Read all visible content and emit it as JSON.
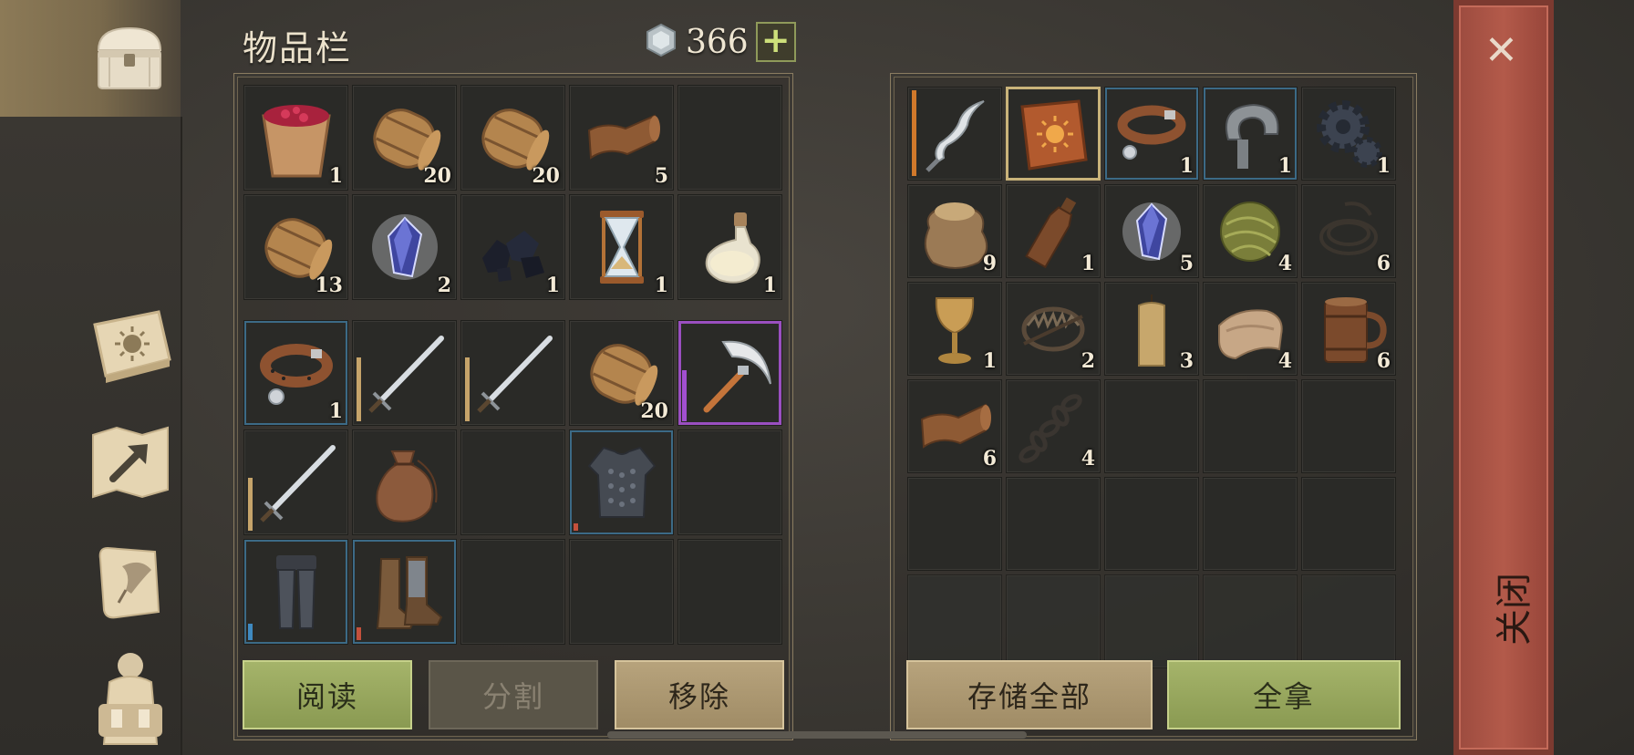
{
  "inventory": {
    "title": "物品栏",
    "currency": {
      "icon": "gem-coin-icon",
      "value": "366",
      "add_label": "+"
    },
    "top_slots": [
      {
        "icon": "berry-bucket-icon",
        "count": "1"
      },
      {
        "icon": "barrel-icon",
        "count": "20"
      },
      {
        "icon": "barrel-icon",
        "count": "20"
      },
      {
        "icon": "leather-scroll-icon",
        "count": "5"
      },
      {
        "icon": "",
        "count": ""
      },
      {
        "icon": "barrel-icon",
        "count": "13"
      },
      {
        "icon": "crystal-icon",
        "count": "2"
      },
      {
        "icon": "coal-icon",
        "count": "1"
      },
      {
        "icon": "hourglass-icon",
        "count": "1"
      },
      {
        "icon": "potion-icon",
        "count": "1"
      }
    ],
    "bottom_slots": [
      {
        "icon": "collar-icon",
        "count": "1"
      },
      {
        "icon": "sword-icon",
        "count": ""
      },
      {
        "icon": "sword-icon",
        "count": ""
      },
      {
        "icon": "barrel-icon",
        "count": "20"
      },
      {
        "icon": "scythe-icon",
        "count": ""
      },
      {
        "icon": "sword-icon",
        "count": ""
      },
      {
        "icon": "pouch-icon",
        "count": ""
      },
      {
        "icon": "",
        "count": ""
      },
      {
        "icon": "chainmail-icon",
        "count": ""
      },
      {
        "icon": "",
        "count": ""
      },
      {
        "icon": "leg-armor-icon",
        "count": ""
      },
      {
        "icon": "boots-icon",
        "count": ""
      },
      {
        "icon": "",
        "count": ""
      },
      {
        "icon": "",
        "count": ""
      },
      {
        "icon": "",
        "count": ""
      }
    ],
    "buttons": {
      "read": "阅读",
      "split": "分割",
      "remove": "移除"
    }
  },
  "container": {
    "slots": [
      {
        "icon": "curved-dagger-icon",
        "count": ""
      },
      {
        "icon": "sun-book-icon",
        "count": ""
      },
      {
        "icon": "collar-icon",
        "count": "1"
      },
      {
        "icon": "clamp-icon",
        "count": "1"
      },
      {
        "icon": "gear-icon",
        "count": "1"
      },
      {
        "icon": "grain-sack-icon",
        "count": "9"
      },
      {
        "icon": "bottle-icon",
        "count": "1"
      },
      {
        "icon": "crystal-icon",
        "count": "5"
      },
      {
        "icon": "twine-ball-icon",
        "count": "4"
      },
      {
        "icon": "rope-icon",
        "count": "6"
      },
      {
        "icon": "goblet-icon",
        "count": "1"
      },
      {
        "icon": "bear-trap-icon",
        "count": "2"
      },
      {
        "icon": "candle-icon",
        "count": "3"
      },
      {
        "icon": "cloth-icon",
        "count": "4"
      },
      {
        "icon": "tankard-icon",
        "count": "6"
      },
      {
        "icon": "leather-scroll-icon",
        "count": "6"
      },
      {
        "icon": "chain-icon",
        "count": "4"
      }
    ],
    "buttons": {
      "store_all": "存储全部",
      "take_all": "全拿"
    }
  },
  "close": {
    "icon": "close-icon",
    "label": "关闭"
  },
  "rail": [
    "chest-icon",
    "sun-book-icon",
    "map-arrow-icon",
    "quill-scroll-icon",
    "backpack-icon"
  ]
}
